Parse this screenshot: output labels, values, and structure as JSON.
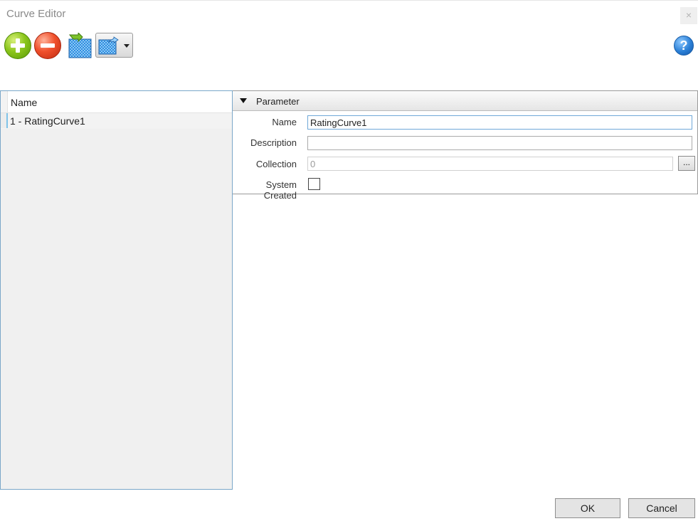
{
  "window": {
    "title": "Curve Editor",
    "close_glyph": "×"
  },
  "toolbar": {
    "add": {
      "icon": "add-icon",
      "color": "#8cc61c"
    },
    "remove": {
      "icon": "remove-icon",
      "color": "#f0502c"
    },
    "import": {
      "icon": "curve-import-icon"
    },
    "export": {
      "icon": "curve-export-dropdown-icon"
    },
    "help": {
      "icon": "help-icon",
      "glyph": "?"
    }
  },
  "list": {
    "header": "Name",
    "items": [
      {
        "label": "1 - RatingCurve1"
      }
    ]
  },
  "properties": {
    "section_title": "Parameter",
    "name_label": "Name",
    "name_value": "RatingCurve1",
    "description_label": "Description",
    "description_value": "",
    "collection_label": "Collection",
    "collection_value": "0",
    "collection_browse": "...",
    "system_created_label": "System Created",
    "system_created_checked": false
  },
  "footer": {
    "ok_label": "OK",
    "cancel_label": "Cancel"
  },
  "colors": {
    "list_border": "#7aa7c9",
    "selection_marker": "#7fc3e8",
    "help_blue": "#2a7fd6"
  }
}
